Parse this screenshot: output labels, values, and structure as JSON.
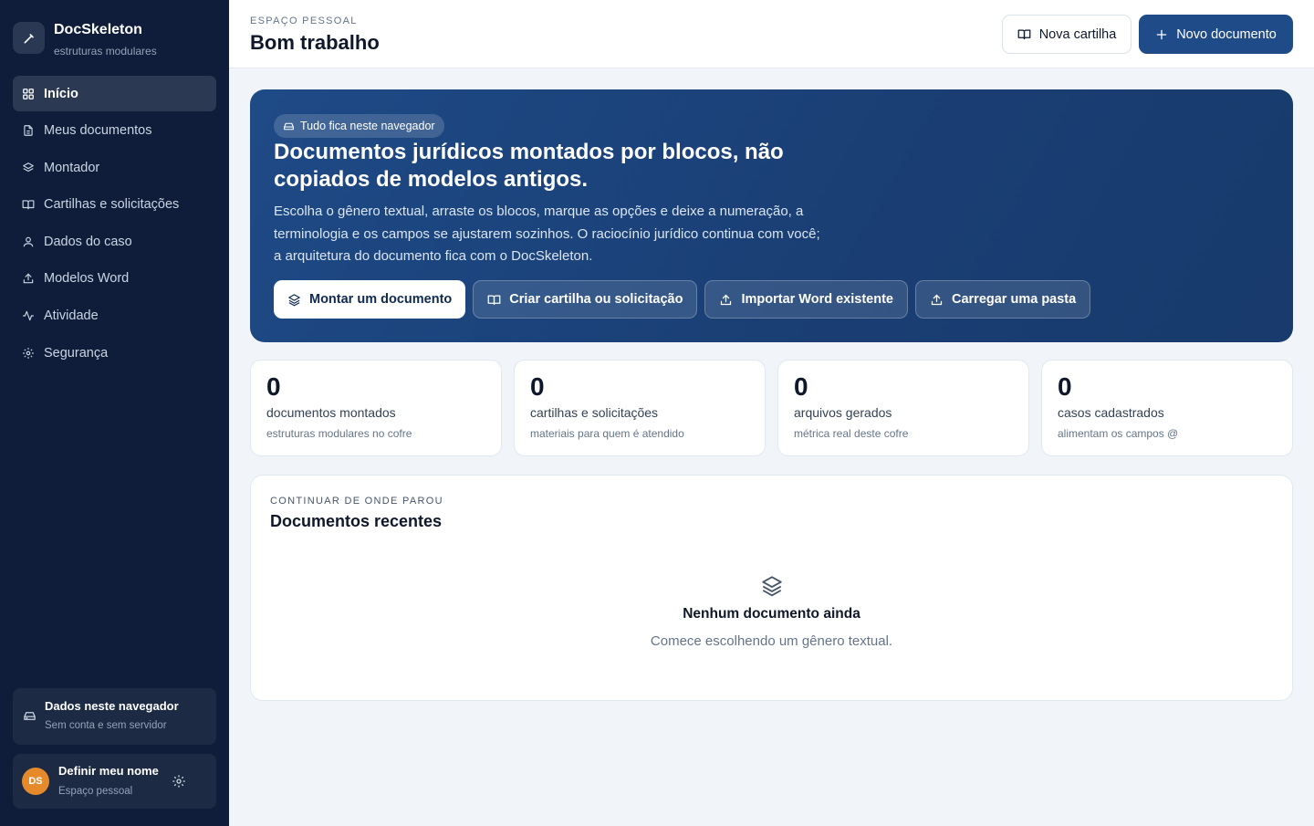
{
  "brand": {
    "name": "DocSkeleton",
    "subtitle": "estruturas modulares",
    "icon": "wand-icon"
  },
  "sidebar": {
    "items": [
      {
        "label": "Início",
        "icon": "grid-icon",
        "active": true
      },
      {
        "label": "Meus documentos",
        "icon": "file-icon",
        "active": false
      },
      {
        "label": "Montador",
        "icon": "layers-icon",
        "active": false
      },
      {
        "label": "Cartilhas e solicitações",
        "icon": "book-icon",
        "active": false
      },
      {
        "label": "Dados do caso",
        "icon": "user-icon",
        "active": false
      },
      {
        "label": "Modelos Word",
        "icon": "upload-icon",
        "active": false
      },
      {
        "label": "Atividade",
        "icon": "activity-icon",
        "active": false
      },
      {
        "label": "Segurança",
        "icon": "gear-icon",
        "active": false
      }
    ],
    "storage": {
      "title": "Dados neste navegador",
      "subtitle": "Sem conta e sem servidor",
      "icon": "drive-icon"
    },
    "user": {
      "initials": "DS",
      "name": "Definir meu nome",
      "subtitle": "Espaço pessoal",
      "avatar_color": "#e58a2a"
    }
  },
  "header": {
    "eyebrow": "ESPAÇO PESSOAL",
    "title": "Bom trabalho",
    "btn_secondary": "Nova cartilha",
    "btn_primary": "Novo documento"
  },
  "hero": {
    "badge": "Tudo fica neste navegador",
    "title": "Documentos jurídicos montados por blocos, não copiados de modelos antigos.",
    "description": "Escolha o gênero textual, arraste os blocos, marque as opções e deixe a numeração, a terminologia e os campos se ajustarem sozinhos. O raciocínio jurídico continua com você; a arquitetura do documento fica com o DocSkeleton.",
    "actions": [
      {
        "label": "Montar um documento",
        "icon": "layers-icon"
      },
      {
        "label": "Criar cartilha ou solicitação",
        "icon": "book-icon"
      },
      {
        "label": "Importar Word existente",
        "icon": "upload-icon"
      },
      {
        "label": "Carregar uma pasta",
        "icon": "upload-icon"
      }
    ]
  },
  "stats": [
    {
      "value": "0",
      "label": "documentos montados",
      "sub": "estruturas modulares no cofre"
    },
    {
      "value": "0",
      "label": "cartilhas e solicitações",
      "sub": "materiais para quem é atendido"
    },
    {
      "value": "0",
      "label": "arquivos gerados",
      "sub": "métrica real deste cofre"
    },
    {
      "value": "0",
      "label": "casos cadastrados",
      "sub": "alimentam os campos @"
    }
  ],
  "recent": {
    "eyebrow": "CONTINUAR DE ONDE PAROU",
    "title": "Documentos recentes",
    "empty_title": "Nenhum documento ainda",
    "empty_subtitle": "Comece escolhendo um gênero textual.",
    "empty_icon": "layers-icon"
  },
  "colors": {
    "sidebar_bg": "#0f1d3a",
    "primary": "#1f4c89",
    "hero_bg": "#1e4a86",
    "page_bg": "#f1f4f9"
  }
}
